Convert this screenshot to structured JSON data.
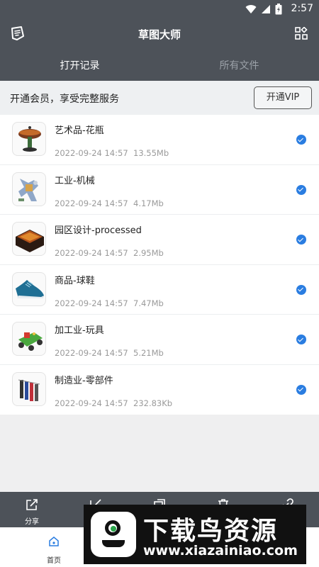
{
  "status_bar": {
    "time": "2:57",
    "wifi_icon": "wifi-icon",
    "signal_icon": "signal-icon",
    "battery_icon": "battery-charging-icon"
  },
  "app_bar": {
    "title": "草图大师",
    "left_icon": "sketch-logo-icon",
    "right_icon": "grid-apps-icon"
  },
  "tabs": [
    {
      "label": "打开记录",
      "active": true
    },
    {
      "label": "所有文件",
      "active": false
    }
  ],
  "vip": {
    "message": "开通会员，享受完整服务",
    "button_label": "开通VIP"
  },
  "files": [
    {
      "name": "艺术品-花瓶",
      "date": "2022-09-24 14:57",
      "size": "13.55Mb",
      "thumb": "lamp-vase-thumbnail",
      "checked": true
    },
    {
      "name": "工业-机械",
      "date": "2022-09-24 14:57",
      "size": "4.17Mb",
      "thumb": "machine-thumbnail",
      "checked": true
    },
    {
      "name": "园区设计-processed",
      "date": "2022-09-24 14:57",
      "size": "2.95Mb",
      "thumb": "park-design-thumbnail",
      "checked": true
    },
    {
      "name": "商品-球鞋",
      "date": "2022-09-24 14:57",
      "size": "7.47Mb",
      "thumb": "sneaker-thumbnail",
      "checked": true
    },
    {
      "name": "加工业-玩具",
      "date": "2022-09-24 14:57",
      "size": "5.21Mb",
      "thumb": "toy-thumbnail",
      "checked": true
    },
    {
      "name": "制造业-零部件",
      "date": "2022-09-24 14:57",
      "size": "232.83Kb",
      "thumb": "parts-thumbnail",
      "checked": true
    }
  ],
  "toolbar": {
    "share_label": "分享",
    "share_icon": "share-icon",
    "edit_icon": "edit-icon",
    "copy_icon": "copy-icon",
    "delete_icon": "delete-icon",
    "link_icon": "link-icon"
  },
  "bottom_nav": {
    "home_label": "首页",
    "home_icon": "home-icon"
  },
  "watermark": {
    "title": "下载鸟资源",
    "url": "www.xiazainiao.com"
  },
  "colors": {
    "header": "#4d5259",
    "accent": "#2a7de1",
    "background": "#efeff0"
  }
}
